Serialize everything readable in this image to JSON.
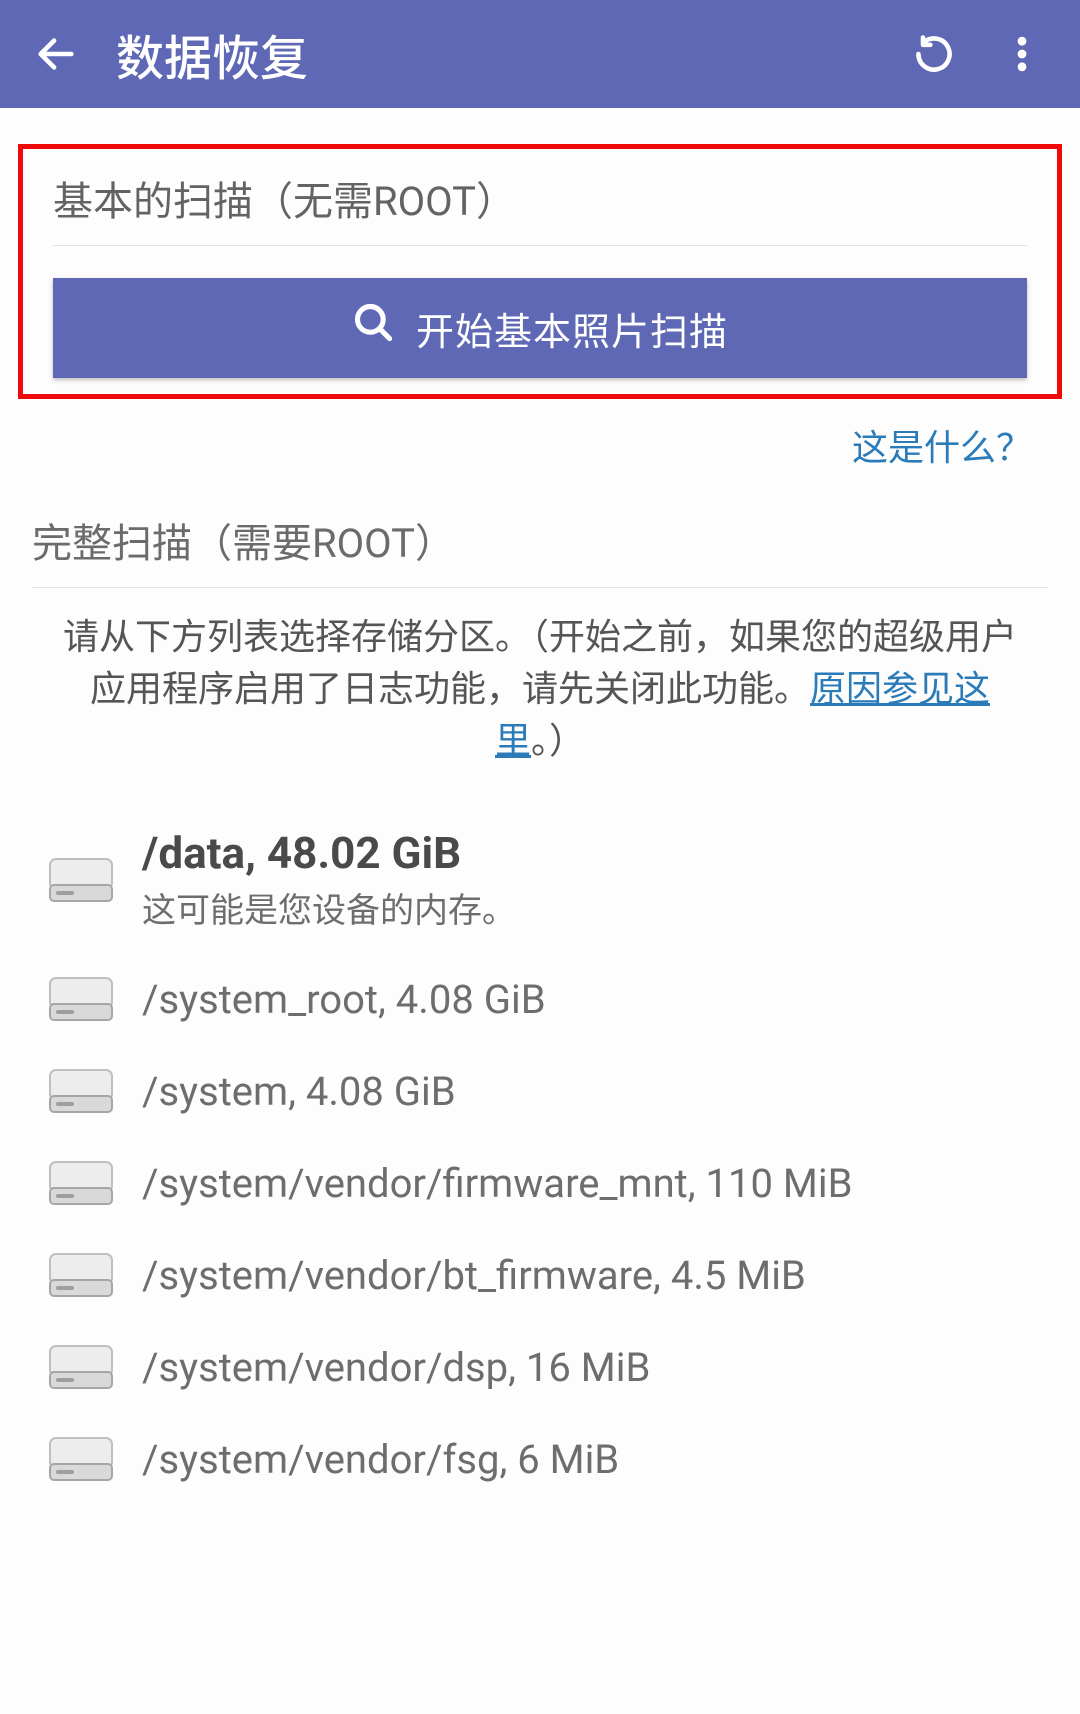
{
  "header": {
    "title": "数据恢复"
  },
  "basic": {
    "title": "基本的扫描（无需ROOT）",
    "button_label": "开始基本照片扫描",
    "help_label": "这是什么？"
  },
  "full": {
    "title": "完整扫描（需要ROOT）",
    "desc_part1": "请从下方列表选择存储分区。（开始之前，如果您的超级用户应用程序启用了日志功能，请先关闭此功能。",
    "desc_link": "原因参见这里",
    "desc_part2": "。）"
  },
  "partitions": [
    {
      "label": "/data, 48.02 GiB",
      "sub": "这可能是您设备的内存。",
      "bold": true
    },
    {
      "label": "/system_root, 4.08 GiB",
      "sub": "",
      "bold": false
    },
    {
      "label": "/system, 4.08 GiB",
      "sub": "",
      "bold": false
    },
    {
      "label": "/system/vendor/firmware_mnt, 110 MiB",
      "sub": "",
      "bold": false
    },
    {
      "label": "/system/vendor/bt_firmware, 4.5 MiB",
      "sub": "",
      "bold": false
    },
    {
      "label": "/system/vendor/dsp, 16 MiB",
      "sub": "",
      "bold": false
    },
    {
      "label": "/system/vendor/fsg, 6 MiB",
      "sub": "",
      "bold": false
    }
  ]
}
